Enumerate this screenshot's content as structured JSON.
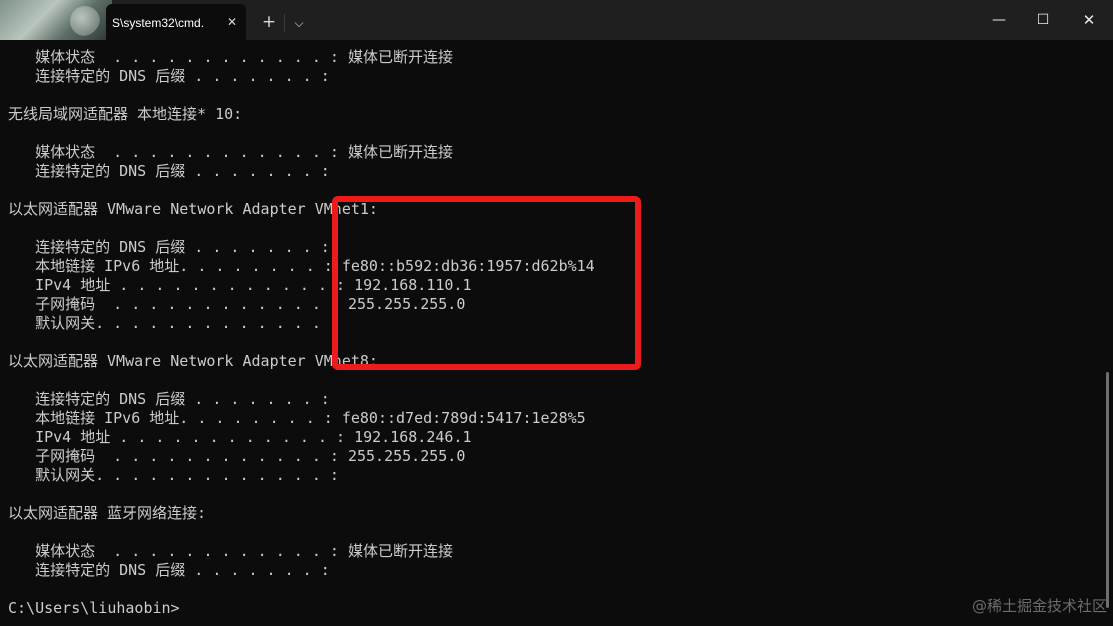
{
  "titlebar": {
    "tab_title": "S\\system32\\cmd.",
    "tab_close_glyph": "✕",
    "new_tab_glyph": "+",
    "dropdown_glyph": "⌵",
    "minimize_glyph": "—",
    "maximize_glyph": "☐",
    "close_glyph": "✕"
  },
  "console": {
    "lines": [
      "   媒体状态  . . . . . . . . . . . . : 媒体已断开连接",
      "   连接特定的 DNS 后缀 . . . . . . . :",
      "",
      "无线局域网适配器 本地连接* 10:",
      "",
      "   媒体状态  . . . . . . . . . . . . : 媒体已断开连接",
      "   连接特定的 DNS 后缀 . . . . . . . :",
      "",
      "以太网适配器 VMware Network Adapter VMnet1:",
      "",
      "   连接特定的 DNS 后缀 . . . . . . . :",
      "   本地链接 IPv6 地址. . . . . . . . : fe80::b592:db36:1957:d62b%14",
      "   IPv4 地址 . . . . . . . . . . . . : 192.168.110.1",
      "   子网掩码  . . . . . . . . . . . . : 255.255.255.0",
      "   默认网关. . . . . . . . . . . . . :",
      "",
      "以太网适配器 VMware Network Adapter VMnet8:",
      "",
      "   连接特定的 DNS 后缀 . . . . . . . :",
      "   本地链接 IPv6 地址. . . . . . . . : fe80::d7ed:789d:5417:1e28%5",
      "   IPv4 地址 . . . . . . . . . . . . : 192.168.246.1",
      "   子网掩码  . . . . . . . . . . . . : 255.255.255.0",
      "   默认网关. . . . . . . . . . . . . :",
      "",
      "以太网适配器 蓝牙网络连接:",
      "",
      "   媒体状态  . . . . . . . . . . . . : 媒体已断开连接",
      "   连接特定的 DNS 后缀 . . . . . . . :",
      "",
      "C:\\Users\\liuhaobin>"
    ]
  },
  "watermark": "@稀土掘金技术社区",
  "colors": {
    "background": "#0c0c0c",
    "titlebar": "#1f1f1f",
    "text": "#cccccc",
    "highlight_box": "#ee1b1b"
  }
}
